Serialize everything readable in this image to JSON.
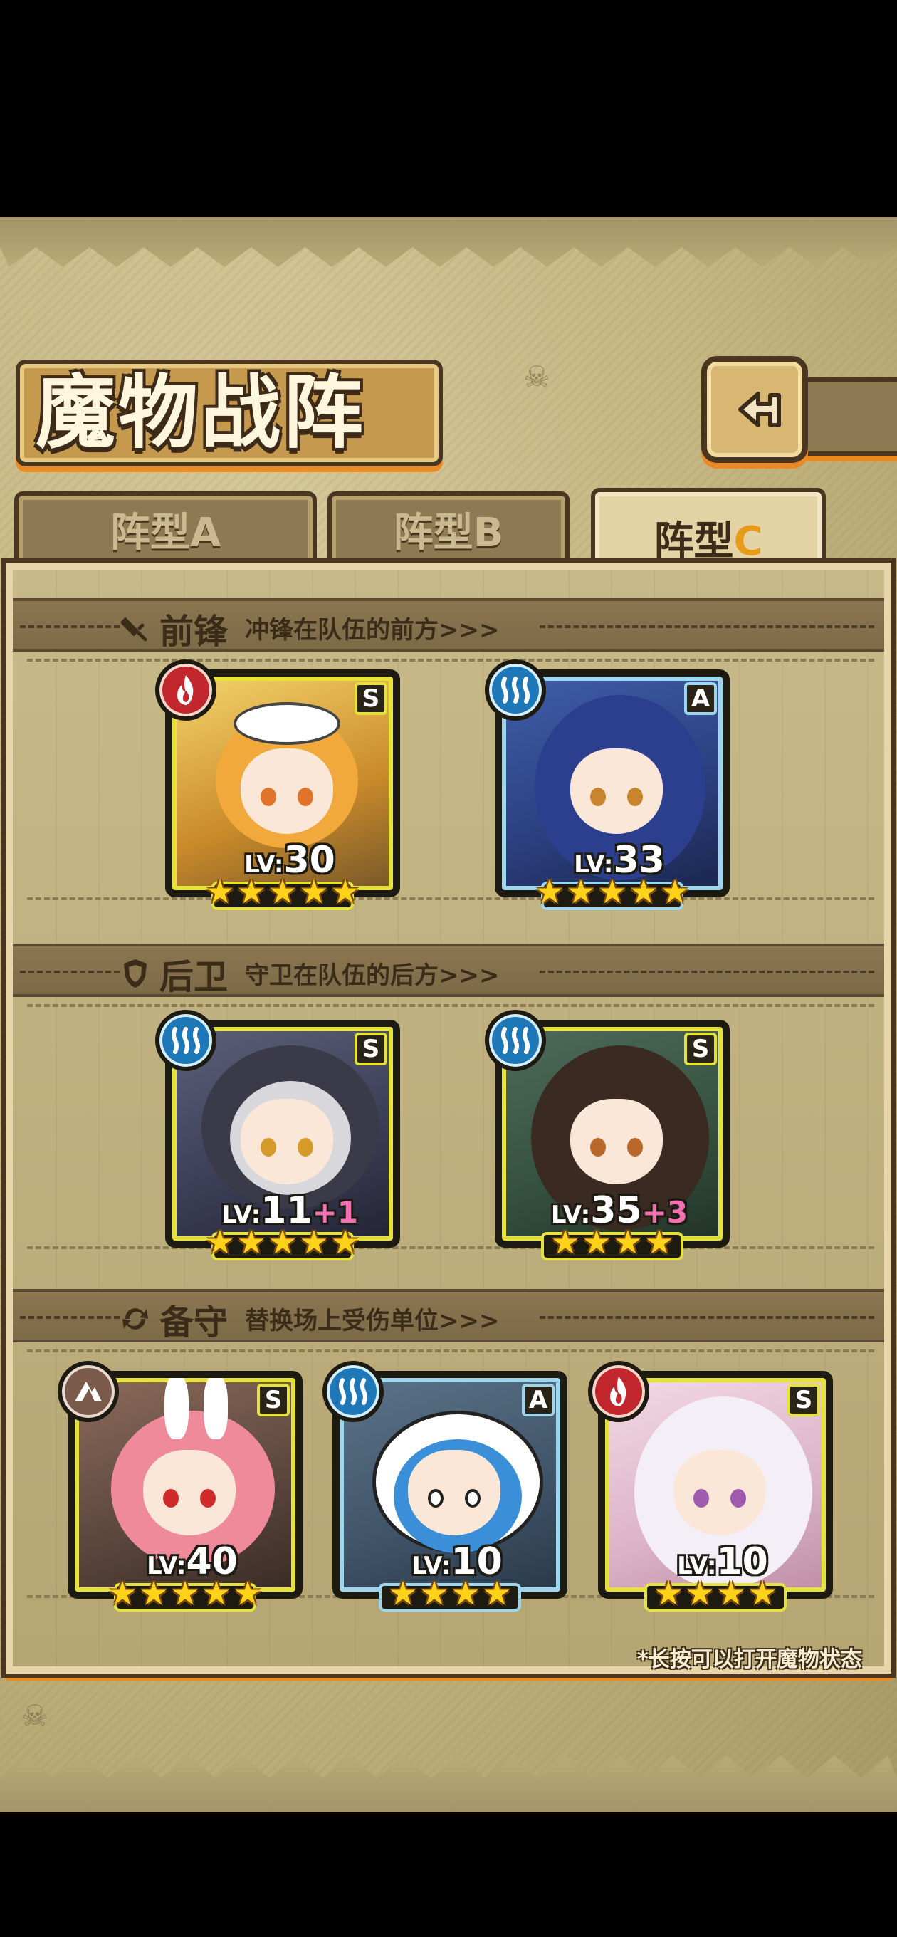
{
  "header": {
    "title": "魔物战阵"
  },
  "tabs": [
    {
      "label": "阵型A",
      "active": false
    },
    {
      "label": "阵型B",
      "active": false
    },
    {
      "label": "阵型",
      "accent": "C",
      "active": true
    }
  ],
  "sections": [
    {
      "name": "前锋",
      "description": "冲锋在队伍的前方>>>",
      "icon": "sword-icon"
    },
    {
      "name": "后卫",
      "description": "守卫在队伍的后方>>>",
      "icon": "shield-icon"
    },
    {
      "name": "备守",
      "description": "替换场上受伤单位>>>",
      "icon": "swap-icon"
    }
  ],
  "monsters": [
    {
      "section": "前锋",
      "element": "fire",
      "rank": "S",
      "level_prefix": "LV:",
      "level": "30",
      "bonus": "",
      "stars": 5
    },
    {
      "section": "前锋",
      "element": "water",
      "rank": "A",
      "level_prefix": "LV:",
      "level": "33",
      "bonus": "",
      "stars": 5
    },
    {
      "section": "后卫",
      "element": "water",
      "rank": "S",
      "level_prefix": "LV:",
      "level": "11",
      "bonus": "+1",
      "stars": 5
    },
    {
      "section": "后卫",
      "element": "water",
      "rank": "S",
      "level_prefix": "LV:",
      "level": "35",
      "bonus": "+3",
      "stars": 4
    },
    {
      "section": "备守",
      "element": "earth",
      "rank": "S",
      "level_prefix": "LV:",
      "level": "40",
      "bonus": "",
      "stars": 5
    },
    {
      "section": "备守",
      "element": "water",
      "rank": "A",
      "level_prefix": "LV:",
      "level": "10",
      "bonus": "",
      "stars": 4
    },
    {
      "section": "备守",
      "element": "fire",
      "rank": "S",
      "level_prefix": "LV:",
      "level": "10",
      "bonus": "",
      "stars": 4
    }
  ],
  "footer": {
    "hint": "*长按可以打开魔物状态"
  },
  "colors": {
    "accent_orange": "#e98a24",
    "frame_dark": "#4a3521",
    "rank_s": "#e6e23c",
    "rank_a": "#9ed6ee",
    "bonus_pink": "#f26fb0"
  }
}
